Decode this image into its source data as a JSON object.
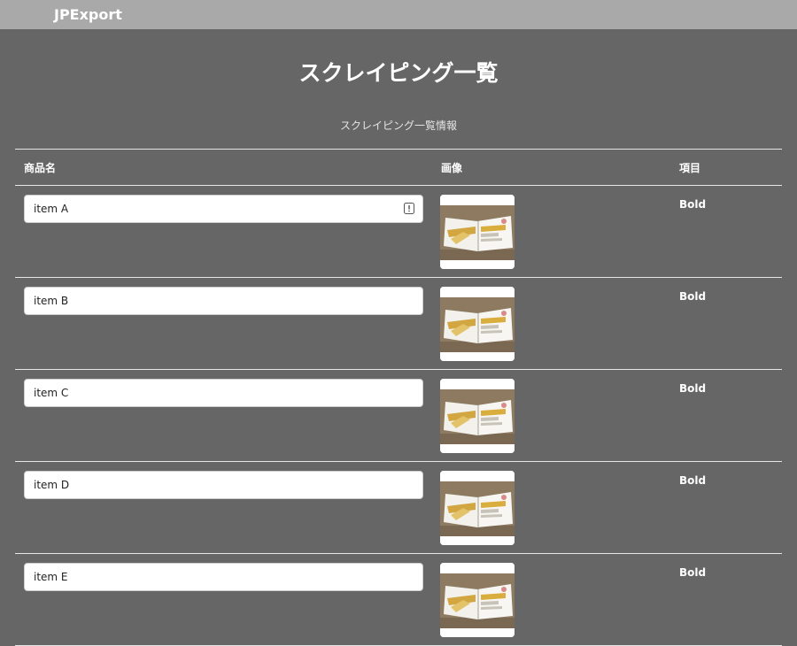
{
  "navbar": {
    "brand": "JPExport"
  },
  "page": {
    "title": "スクレイピング一覧",
    "subtitle": "スクレイピング一覧情報"
  },
  "table": {
    "headers": {
      "name": "商品名",
      "image": "画像",
      "field": "項目"
    },
    "rows": [
      {
        "name": "item A",
        "field": "Bold",
        "image_icon": "open-book-photo",
        "has_warning_icon": true
      },
      {
        "name": "item B",
        "field": "Bold",
        "image_icon": "open-book-photo",
        "has_warning_icon": false
      },
      {
        "name": "item C",
        "field": "Bold",
        "image_icon": "open-book-photo",
        "has_warning_icon": false
      },
      {
        "name": "item D",
        "field": "Bold",
        "image_icon": "open-book-photo",
        "has_warning_icon": false
      },
      {
        "name": "item E",
        "field": "Bold",
        "image_icon": "open-book-photo",
        "has_warning_icon": false
      }
    ]
  },
  "colors": {
    "background": "#666666",
    "navbar": "#a9a9a9",
    "text": "#ffffff"
  }
}
